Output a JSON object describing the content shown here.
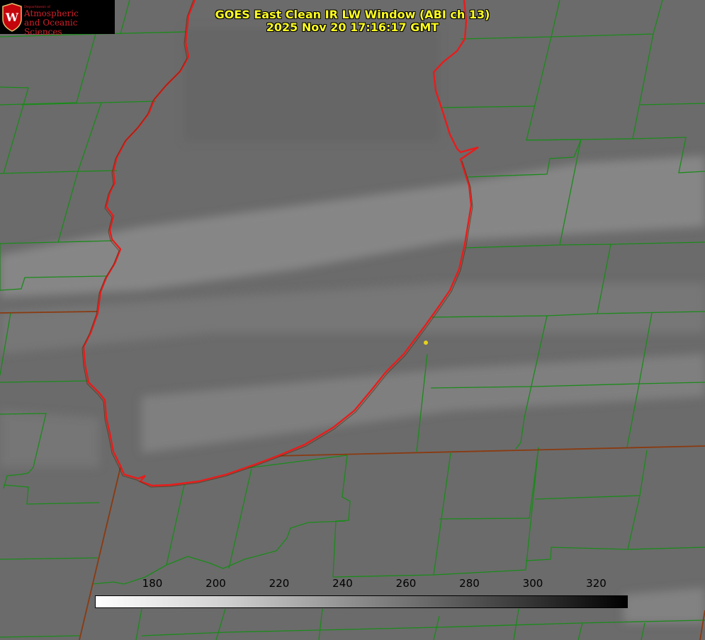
{
  "title": {
    "line1": "GOES East Clean IR LW Window (ABI ch 13)",
    "line2": "2025 Nov 20 17:16:17 GMT"
  },
  "logo": {
    "dept_label": "Department of",
    "name_line1": "Atmospheric",
    "name_line2": "and Oceanic Sciences",
    "emblem_letter": "W"
  },
  "colorbar": {
    "ticks": [
      "180",
      "200",
      "220",
      "240",
      "260",
      "280",
      "300",
      "320"
    ]
  },
  "colors": {
    "lake_outline": "#e81c1c",
    "county_lines": "#1a8a1a",
    "state_line": "#8a3a10",
    "title_text": "#ffff22",
    "marker": "#e6d21a"
  }
}
